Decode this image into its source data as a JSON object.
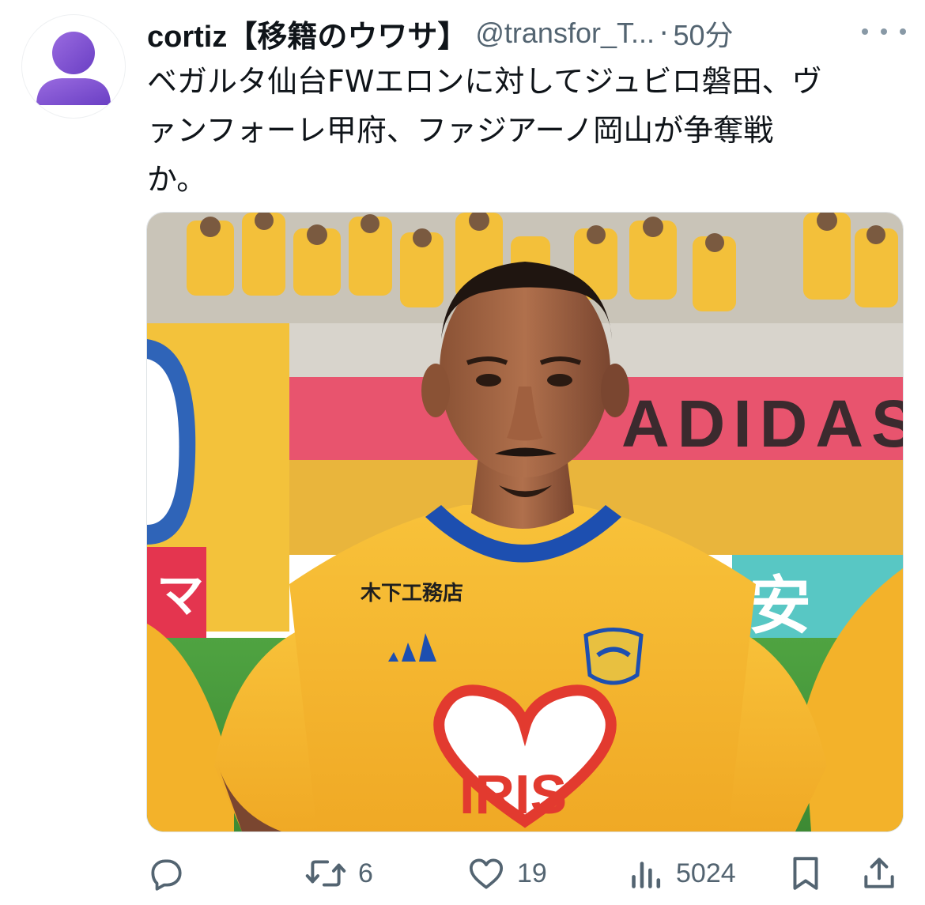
{
  "tweet": {
    "display_name": "cortiz【移籍のウワサ】",
    "handle": "@transfor_T...",
    "separator": "·",
    "time": "50分",
    "text_lines": [
      "ベガルタ仙台FWエロンに対してジュビロ磐田、ヴ",
      "ァンフォーレ甲府、ファジアーノ岡山が争奪戦",
      "か。"
    ]
  },
  "media": {
    "banner_text": "ADIDAS",
    "sponsor_chest": "木下工務店",
    "sponsor_belly": "IRIS",
    "ad_right": "安",
    "ad_left": "マ"
  },
  "actions": {
    "reply_count": "",
    "retweet_count": "6",
    "like_count": "19",
    "views_count": "5024"
  },
  "colors": {
    "avatar_purple": "#7b4fd0",
    "text_primary": "#0f1419",
    "text_secondary": "#536471",
    "jersey_yellow": "#f5b52a",
    "collar_blue": "#1d4fb0",
    "banner_pink": "#e8546e"
  },
  "icons": [
    "more-icon",
    "reply-icon",
    "retweet-icon",
    "like-icon",
    "views-icon",
    "bookmark-icon",
    "share-icon"
  ]
}
